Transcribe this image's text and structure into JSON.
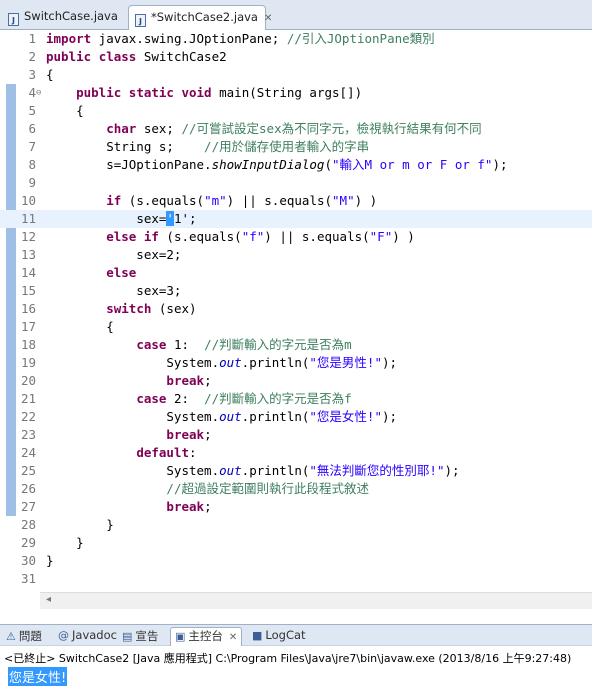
{
  "tabs": {
    "file1": "SwitchCase.java",
    "file2": "*SwitchCase2.java"
  },
  "code": {
    "l1_kw": "import",
    "l1_rest": " javax.swing.JOptionPane; ",
    "l1_comment": "//引入JOptionPane類別",
    "l2_kw1": "public",
    "l2_kw2": "class",
    "l2_rest": " SwitchCase2",
    "l3": "{",
    "l4_kw1": "public",
    "l4_kw2": "static",
    "l4_kw3": "void",
    "l4_rest": " main(String args[])",
    "l5": "    {",
    "l6_kw": "char",
    "l6_rest": " sex; ",
    "l6_comment": "//可嘗試設定sex為不同字元，檢視執行結果有何不同",
    "l7_rest": "        String s;    ",
    "l7_comment": "//用於儲存使用者輸入的字串",
    "l8_a": "        s=JOptionPane.",
    "l8_method": "showInputDialog",
    "l8_b": "(",
    "l8_str": "\"輸入M or m or F or f\"",
    "l8_c": ");",
    "l10_kw": "if",
    "l10_a": " (s.equals(",
    "l10_s1": "\"m\"",
    "l10_b": ") || s.equals(",
    "l10_s2": "\"M\"",
    "l10_c": ") )",
    "l11_a": "sex=",
    "l11_sel": "'",
    "l11_b": "1';",
    "l12_kw": "else if",
    "l12_a": " (s.equals(",
    "l12_s1": "\"f\"",
    "l12_b": ") || s.equals(",
    "l12_s2": "\"F\"",
    "l12_c": ") )",
    "l13": "            sex=2;",
    "l14_kw": "else",
    "l15": "            sex=3;",
    "l16_kw": "switch",
    "l16_rest": " (sex)",
    "l17": "        {",
    "l18_kw": "case",
    "l18_rest": " 1:  ",
    "l18_comment": "//判斷輸入的字元是否為m",
    "l19_a": "                System.",
    "l19_out": "out",
    "l19_b": ".println(",
    "l19_str": "\"您是男性!\"",
    "l19_c": ");",
    "l20_kw": "break",
    "l21_kw": "case",
    "l21_rest": " 2:  ",
    "l21_comment": "//判斷輸入的字元是否為f",
    "l22_a": "                System.",
    "l22_out": "out",
    "l22_b": ".println(",
    "l22_str": "\"您是女性!\"",
    "l22_c": ");",
    "l23_kw": "break",
    "l24_kw": "default",
    "l24_rest": ":",
    "l25_a": "                System.",
    "l25_out": "out",
    "l25_b": ".println(",
    "l25_str": "\"無法判斷您的性別耶!\"",
    "l25_c": ");",
    "l26_comment": "//超過設定範圍則執行此段程式敘述",
    "l27_kw": "break",
    "l28": "        }",
    "l29": "    }",
    "l30": "}",
    "line_numbers": [
      "1",
      "2",
      "3",
      "4",
      "5",
      "6",
      "7",
      "8",
      "9",
      "10",
      "11",
      "12",
      "13",
      "14",
      "15",
      "16",
      "17",
      "18",
      "19",
      "20",
      "21",
      "22",
      "23",
      "24",
      "25",
      "26",
      "27",
      "28",
      "29",
      "30",
      "31"
    ]
  },
  "panel": {
    "tab_problems": "問題",
    "tab_javadoc": "Javadoc",
    "tab_declaration": "宣告",
    "tab_console": "主控台",
    "tab_logcat": "LogCat",
    "status": "<已終止> SwitchCase2 [Java 應用程式] C:\\Program Files\\Java\\jre7\\bin\\javaw.exe (2013/8/16 上午9:27:48)",
    "output": "您是女性!"
  }
}
